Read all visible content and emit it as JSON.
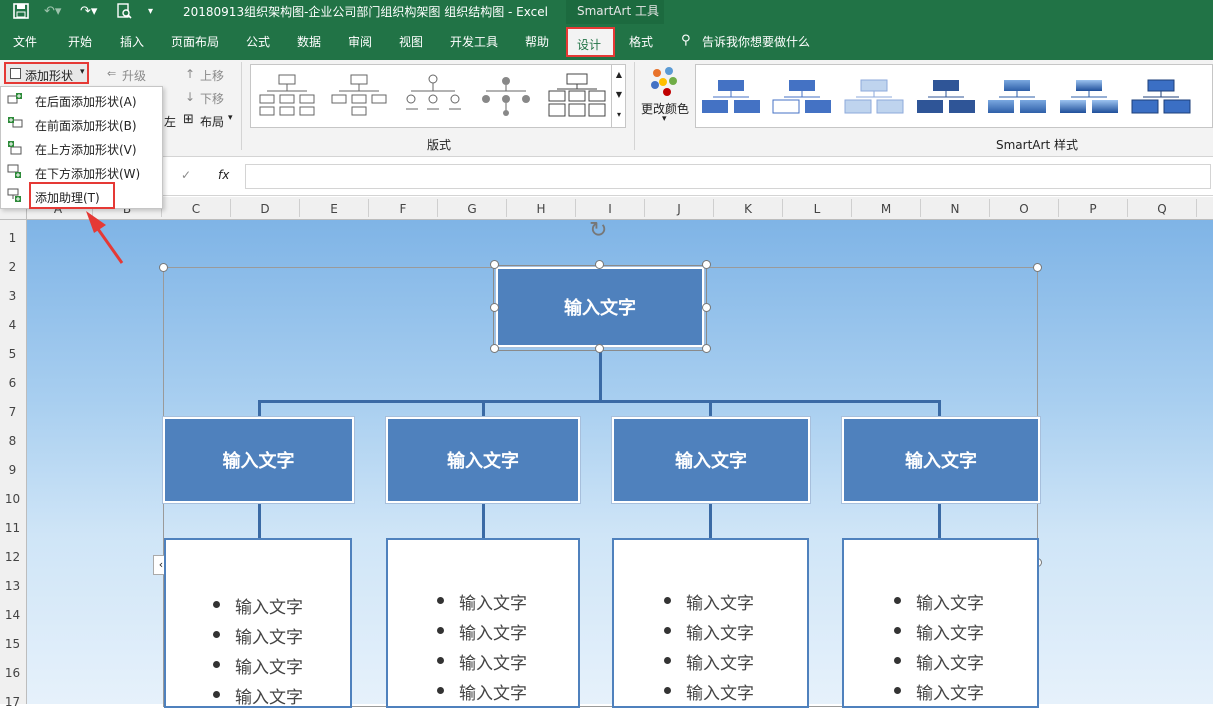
{
  "window": {
    "title": "20180913组织架构图-企业公司部门组织构架图 组织结构图  -  Excel",
    "context_tool": "SmartArt 工具"
  },
  "tabs": [
    "文件",
    "开始",
    "插入",
    "页面布局",
    "公式",
    "数据",
    "审阅",
    "视图",
    "开发工具",
    "帮助",
    "设计",
    "格式"
  ],
  "tell_me": "告诉我你想要做什么",
  "ribbon": {
    "add_shape": "添加形状",
    "promote": "升级",
    "move_up": "上移",
    "move_down": "下移",
    "rtl_partial": "左",
    "layout_btn": "布局",
    "layouts_group": "版式",
    "change_colors": "更改颜色",
    "styles_group": "SmartArt 样式"
  },
  "dropdown": {
    "items": [
      "在后面添加形状(A)",
      "在前面添加形状(B)",
      "在上方添加形状(V)",
      "在下方添加形状(W)",
      "添加助理(T)"
    ]
  },
  "formula": {
    "fx": "fx",
    "confirm": "✓"
  },
  "columns": [
    "A",
    "B",
    "C",
    "D",
    "E",
    "F",
    "G",
    "H",
    "I",
    "J",
    "K",
    "L",
    "M",
    "N",
    "O",
    "P",
    "Q"
  ],
  "rows": [
    "1",
    "2",
    "3",
    "4",
    "5",
    "6",
    "7",
    "8",
    "9",
    "10",
    "11",
    "12",
    "13",
    "14",
    "15",
    "16",
    "17"
  ],
  "smartart": {
    "top": "输入文字",
    "level2": [
      "输入文字",
      "输入文字",
      "输入文字",
      "输入文字"
    ],
    "bullets": [
      "输入文字",
      "输入文字",
      "输入文字",
      "输入文字"
    ]
  },
  "colors": {
    "excel_green": "#217346",
    "highlight_red": "#e53935",
    "node_blue": "#4f81bd"
  }
}
